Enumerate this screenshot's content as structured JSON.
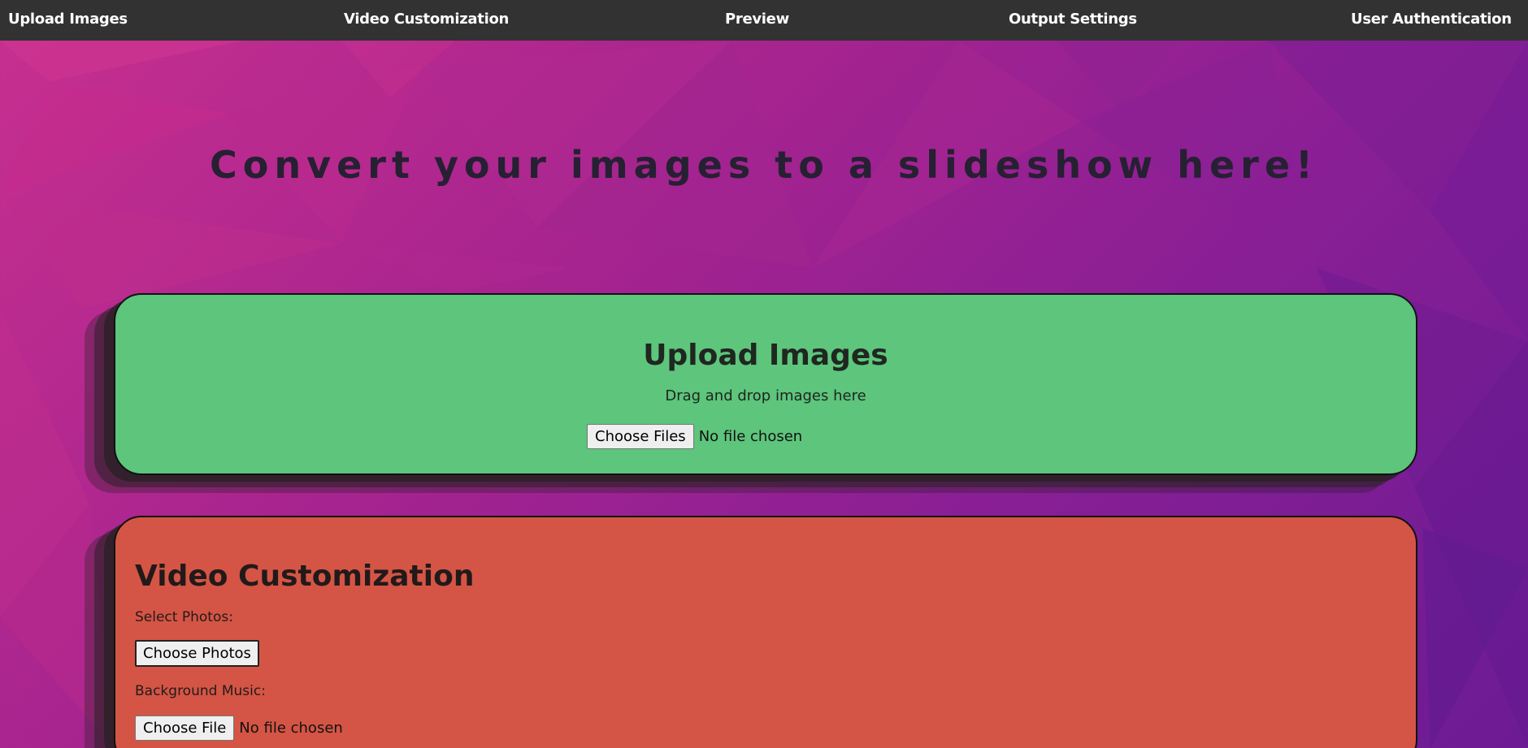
{
  "nav": {
    "items": [
      {
        "label": "Upload Images"
      },
      {
        "label": "Video Customization"
      },
      {
        "label": "Preview"
      },
      {
        "label": "Output Settings"
      },
      {
        "label": "User Authentication"
      }
    ]
  },
  "hero": {
    "title": "Convert your images to a slideshow here!"
  },
  "upload_section": {
    "title": "Upload Images",
    "subtitle": "Drag and drop images here",
    "button_label": "Choose Files",
    "status": "No file chosen",
    "background_color": "#5dc57c"
  },
  "video_section": {
    "title": "Video Customization",
    "select_photos_label": "Select Photos:",
    "choose_photos_button": "Choose Photos",
    "background_music_label": "Background Music:",
    "choose_file_button": "Choose File",
    "music_status": "No file chosen",
    "background_color": "#d45545"
  },
  "colors": {
    "nav_bg": "#323232",
    "page_gradient_start": "#c8308f",
    "page_gradient_end": "#6c1b94"
  }
}
